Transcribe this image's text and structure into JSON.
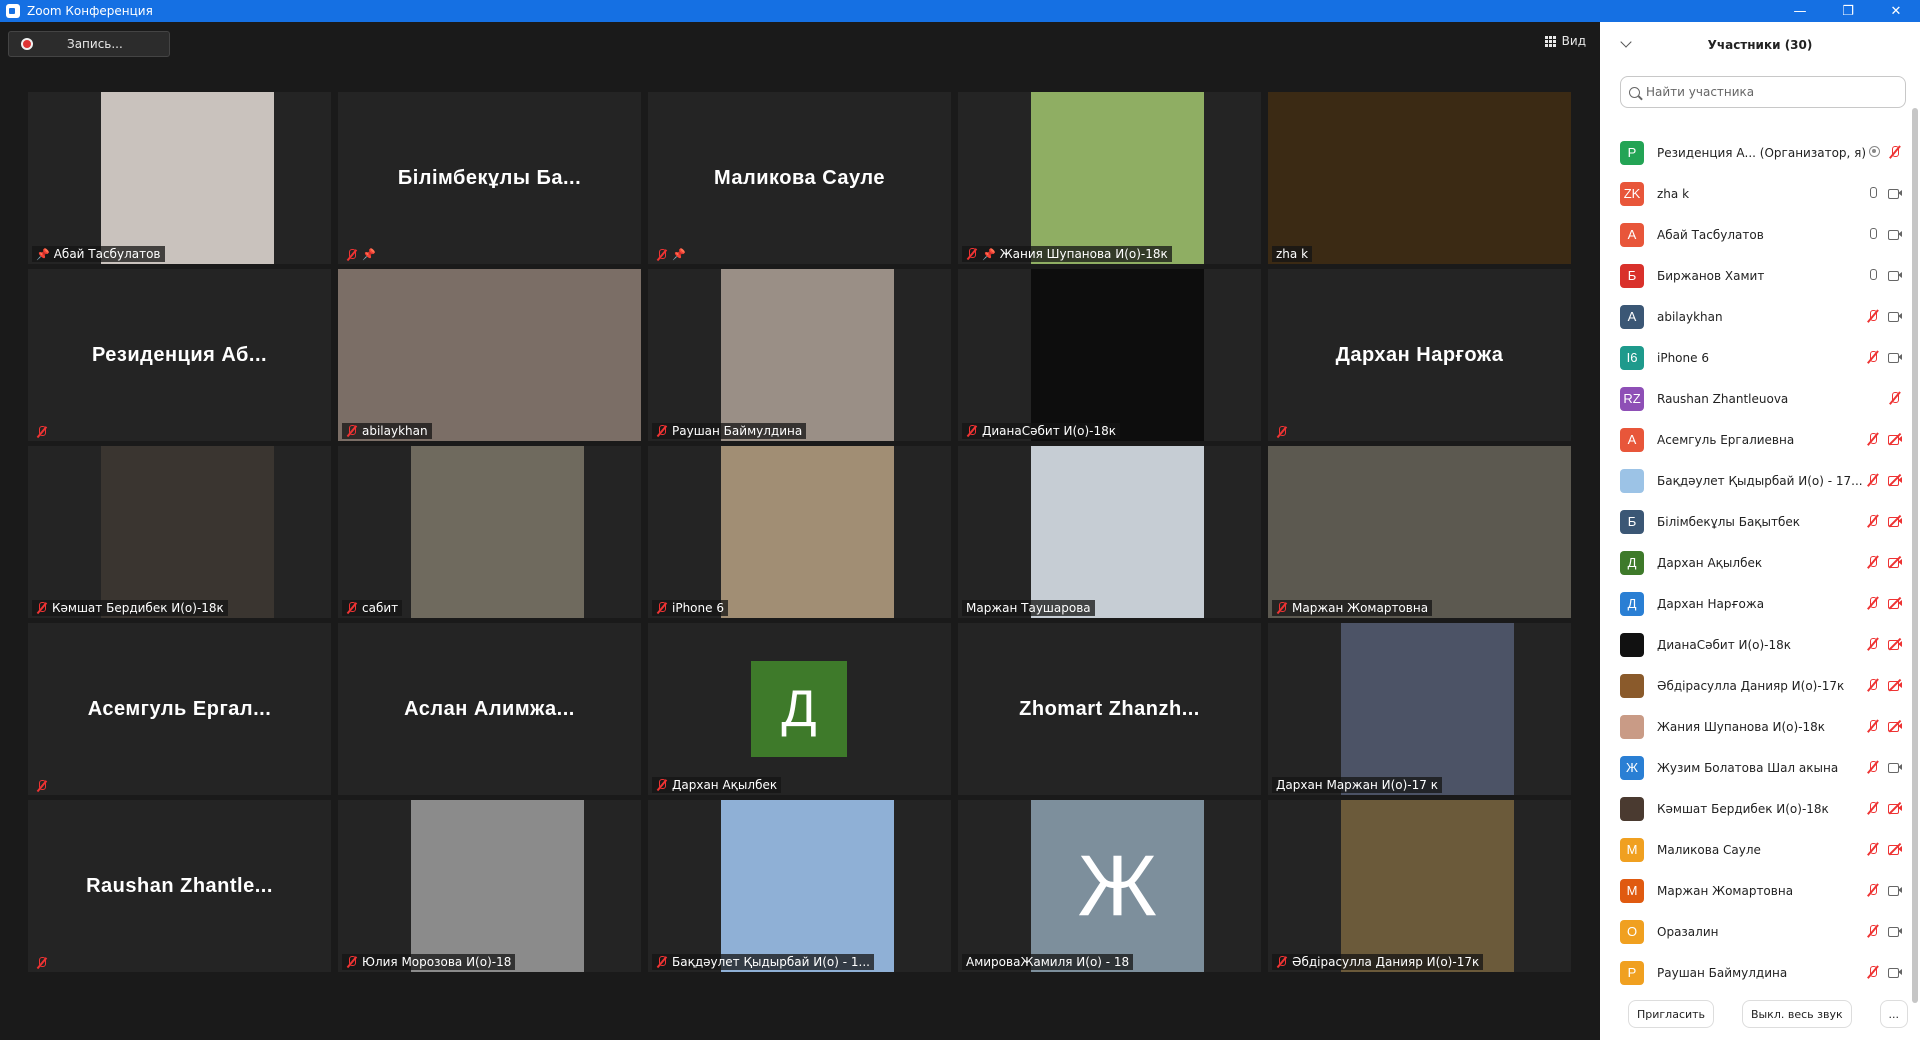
{
  "window": {
    "title": "Zoom Конференция",
    "controls": [
      "—",
      "❐",
      "✕"
    ]
  },
  "toolbar": {
    "record_label": "Запись...",
    "view_label": "Вид"
  },
  "tiles": [
    {
      "name": "Абай Тасбулатов",
      "pinned": true,
      "muted": false,
      "kind": "video",
      "bg": "#c9c2bd"
    },
    {
      "name": "Білімбекұлы Ба...",
      "label": "",
      "pinned": true,
      "muted": true,
      "kind": "name"
    },
    {
      "name": "Маликова Сауле",
      "label": "",
      "pinned": true,
      "muted": true,
      "kind": "name"
    },
    {
      "name": "Жания Шупанова И(о)-18к",
      "pinned": true,
      "muted": true,
      "kind": "video",
      "bg": "#8fae63"
    },
    {
      "name": "zha k",
      "pinned": false,
      "muted": false,
      "kind": "video",
      "bg": "#3b2a14",
      "active": true
    },
    {
      "name": "Резиденция Аб...",
      "label": "",
      "pinned": false,
      "muted": true,
      "kind": "name"
    },
    {
      "name": "abilaykhan",
      "pinned": false,
      "muted": true,
      "kind": "video",
      "bg": "#7b6e66"
    },
    {
      "name": "Раушан Баймулдина",
      "pinned": false,
      "muted": true,
      "kind": "video",
      "bg": "#9a8f86"
    },
    {
      "name": "ДианаСәбит И(о)-18к",
      "pinned": false,
      "muted": true,
      "kind": "video",
      "bg": "#0d0d0d"
    },
    {
      "name": "Дархан Нарғожа",
      "label": "",
      "pinned": false,
      "muted": true,
      "kind": "name"
    },
    {
      "name": "Кәмшат Бердибек И(о)-18к",
      "pinned": false,
      "muted": true,
      "kind": "video",
      "bg": "#3a3530"
    },
    {
      "name": "сабит",
      "pinned": false,
      "muted": true,
      "kind": "video",
      "bg": "#6f6a5e"
    },
    {
      "name": "iPhone 6",
      "pinned": false,
      "muted": true,
      "kind": "video",
      "bg": "#a18e74"
    },
    {
      "name": "Маржан Таушарова",
      "pinned": false,
      "muted": false,
      "kind": "video",
      "bg": "#c6cdd4"
    },
    {
      "name": "Маржан Жомартовна",
      "pinned": false,
      "muted": true,
      "kind": "video",
      "bg": "#5c5950"
    },
    {
      "name": "Асемгуль Ергал...",
      "label": "",
      "pinned": false,
      "muted": true,
      "kind": "name"
    },
    {
      "name": "Аслан Алимжа...",
      "label": "",
      "pinned": false,
      "muted": false,
      "kind": "name"
    },
    {
      "name": "Дархан Ақылбек",
      "pinned": false,
      "muted": true,
      "kind": "avatar",
      "letter": "Д",
      "bg": "#3e7a2a"
    },
    {
      "name": "Zhomart Zhanzh...",
      "label": "",
      "pinned": false,
      "muted": false,
      "kind": "name"
    },
    {
      "name": "Дархан Маржан И(о)-17 к",
      "pinned": false,
      "muted": false,
      "kind": "video",
      "bg": "#4c5366"
    },
    {
      "name": "Raushan Zhantle...",
      "label": "",
      "pinned": false,
      "muted": true,
      "kind": "name"
    },
    {
      "name": "Юлия Морозова И(о)-18",
      "pinned": false,
      "muted": true,
      "kind": "video",
      "bg": "#8b8b8b"
    },
    {
      "name": "Бақдәулет Қыдырбай И(о) - 1...",
      "pinned": false,
      "muted": true,
      "kind": "video",
      "bg": "#8fb0d6"
    },
    {
      "name": "АмироваЖамиля И(о) - 18",
      "pinned": false,
      "muted": false,
      "kind": "avatar",
      "letter": "Ж",
      "bg": "#7d8f9c"
    },
    {
      "name": "Әбдірасулла Данияр И(о)-17к",
      "pinned": false,
      "muted": true,
      "kind": "video",
      "bg": "#6b5a3a"
    }
  ],
  "panel": {
    "title": "Участники (30)",
    "search_placeholder": "Найти участника",
    "participants": [
      {
        "initials": "Р",
        "color": "#23a455",
        "name": "Резиденция А... (Организатор, я)",
        "mic": "off",
        "video": "none",
        "host": true
      },
      {
        "initials": "ZK",
        "color": "#e8563a",
        "name": "zha k",
        "mic": "on",
        "video": "on"
      },
      {
        "initials": "А",
        "color": "#e8563a",
        "name": "Абай Тасбулатов",
        "mic": "on",
        "video": "on"
      },
      {
        "initials": "Б",
        "color": "#d9312b",
        "name": "Биржанов Хамит",
        "mic": "on",
        "video": "on"
      },
      {
        "initials": "A",
        "color": "#3b5775",
        "name": "abilaykhan",
        "mic": "off",
        "video": "on"
      },
      {
        "initials": "I6",
        "color": "#1e9a8c",
        "name": "iPhone 6",
        "mic": "off",
        "video": "on"
      },
      {
        "initials": "RZ",
        "color": "#8e4fb6",
        "name": "Raushan Zhantleuova",
        "mic": "off",
        "video": "none"
      },
      {
        "initials": "А",
        "color": "#e8563a",
        "name": "Асемгуль Ергалиевна",
        "mic": "off",
        "video": "off"
      },
      {
        "initials": "",
        "color": "#9cc3e6",
        "name": "Бақдәулет Қыдырбай И(о) - 17...",
        "mic": "off",
        "video": "off"
      },
      {
        "initials": "Б",
        "color": "#3b5775",
        "name": "Білімбекұлы Бақытбек",
        "mic": "off",
        "video": "off"
      },
      {
        "initials": "Д",
        "color": "#3e7a2a",
        "name": "Дархан Ақылбек",
        "mic": "off",
        "video": "off"
      },
      {
        "initials": "Д",
        "color": "#2a7fd4",
        "name": "Дархан Нарғожа",
        "mic": "off",
        "video": "off"
      },
      {
        "initials": "",
        "color": "#111111",
        "name": "ДианаСәбит И(о)-18к",
        "mic": "off",
        "video": "off"
      },
      {
        "initials": "",
        "color": "#8a5a2b",
        "name": "Әбдірасулла Данияр И(о)-17к",
        "mic": "off",
        "video": "off"
      },
      {
        "initials": "",
        "color": "#c99b86",
        "name": "Жания Шупанова И(о)-18к",
        "mic": "off",
        "video": "off"
      },
      {
        "initials": "Ж",
        "color": "#2a7fd4",
        "name": "Жузим Болатова Шал акына",
        "mic": "off",
        "video": "on"
      },
      {
        "initials": "",
        "color": "#4a3a30",
        "name": "Кәмшат Бердибек И(о)-18к",
        "mic": "off",
        "video": "off"
      },
      {
        "initials": "М",
        "color": "#f0a020",
        "name": "Маликова Сауле",
        "mic": "off",
        "video": "off"
      },
      {
        "initials": "М",
        "color": "#e05a10",
        "name": "Маржан Жомартовна",
        "mic": "off",
        "video": "on"
      },
      {
        "initials": "О",
        "color": "#f0a020",
        "name": "Оразалин",
        "mic": "off",
        "video": "on"
      },
      {
        "initials": "Р",
        "color": "#f0a020",
        "name": "Раушан Баймулдина",
        "mic": "off",
        "video": "on"
      }
    ],
    "invite_label": "Пригласить",
    "mute_all_label": "Выкл. весь звук",
    "more_label": "..."
  }
}
